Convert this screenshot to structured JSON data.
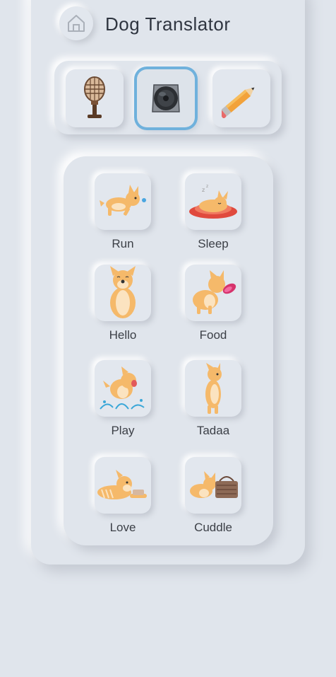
{
  "header": {
    "title": "Dog Translator",
    "home_icon": "home-icon"
  },
  "modes": [
    {
      "name": "microphone",
      "icon": "microphone-icon",
      "active": false
    },
    {
      "name": "speaker",
      "icon": "speaker-icon",
      "active": true
    },
    {
      "name": "pencil",
      "icon": "pencil-icon",
      "active": false
    }
  ],
  "commands": [
    {
      "label": "Run",
      "icon": "dog-running-icon"
    },
    {
      "label": "Sleep",
      "icon": "dog-sleeping-icon"
    },
    {
      "label": "Hello",
      "icon": "dog-sitting-icon"
    },
    {
      "label": "Food",
      "icon": "dog-eating-icon"
    },
    {
      "label": "Play",
      "icon": "dog-splashing-icon"
    },
    {
      "label": "Tadaa",
      "icon": "dog-standing-icon"
    },
    {
      "label": "Love",
      "icon": "dog-lying-icon"
    },
    {
      "label": "Cuddle",
      "icon": "dog-basket-icon"
    }
  ],
  "colors": {
    "background": "#e0e5ec",
    "active_ring": "#6fb1dc",
    "dog_fur": "#f5b96a",
    "text": "#2f3540"
  }
}
